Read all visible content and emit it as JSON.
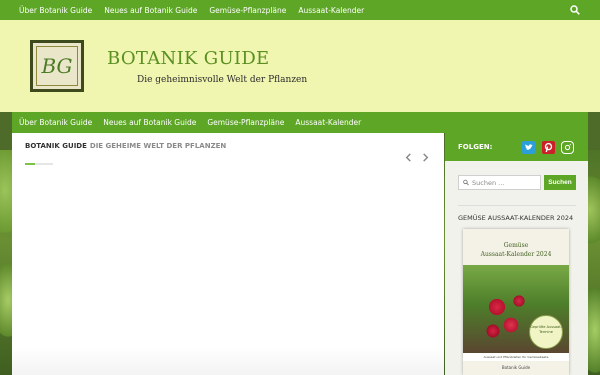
{
  "topnav": {
    "items": [
      {
        "label": "Über Botanik Guide"
      },
      {
        "label": "Neues auf Botanik Guide"
      },
      {
        "label": "Gemüse-Pflanzpläne"
      },
      {
        "label": "Aussaat-Kalender"
      }
    ],
    "search_icon": "search-icon"
  },
  "header": {
    "logo_text": "BG",
    "title": "BOTANIK GUIDE",
    "tagline": "Die geheimnisvolle Welt der Pflanzen"
  },
  "mainnav": {
    "items": [
      {
        "label": "Über Botanik Guide"
      },
      {
        "label": "Neues auf Botanik Guide"
      },
      {
        "label": "Gemüse-Pflanzpläne"
      },
      {
        "label": "Aussaat-Kalender"
      }
    ]
  },
  "content": {
    "breadcrumb_site": "BOTANIK GUIDE",
    "breadcrumb_sub": "DIE GEHEIME WELT DER PFLANZEN",
    "prev_icon": "chevron-left-icon",
    "next_icon": "chevron-right-icon"
  },
  "sidebar": {
    "follow_label": "FOLGEN:",
    "social": [
      "twitter-icon",
      "pinterest-icon",
      "instagram-icon"
    ],
    "search": {
      "placeholder": "Suchen ...",
      "value": "",
      "button_label": "Suchen"
    },
    "widget_title": "GEMÜSE AUSSAAT-KALENDER 2024",
    "calendar": {
      "title_line1": "Gemüse",
      "title_line2": "Aussaat-Kalender 2024",
      "badge": "Geprüfte Aussaat-Termine",
      "strip": "Aussaat und Pflanzzeiten für Gemüsebeete",
      "footer": "Botanik Guide"
    }
  },
  "colors": {
    "accent": "#5ea626",
    "header_bg": "#f0f5b0",
    "title": "#5a8f22"
  }
}
